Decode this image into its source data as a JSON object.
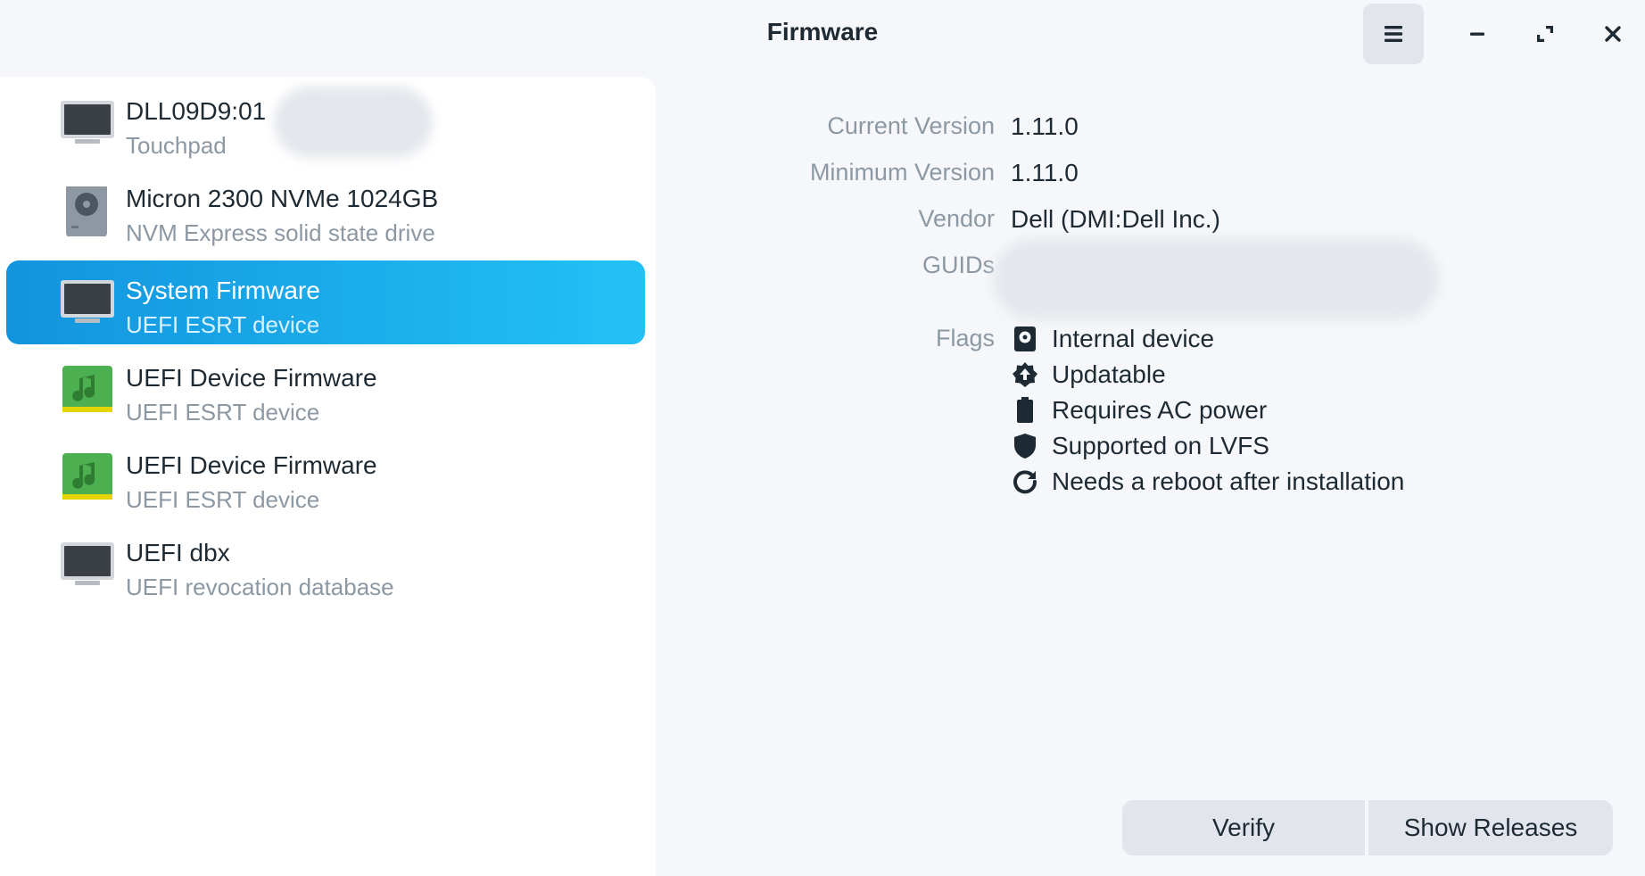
{
  "window": {
    "title": "Firmware",
    "menu_icon": "hamburger-icon",
    "minimize_icon": "minimize-icon",
    "maximize_icon": "maximize-icon",
    "close_icon": "close-icon"
  },
  "devices": [
    {
      "title": "DLL09D9:01",
      "subtitle": "Touchpad",
      "icon": "computer-icon",
      "selected": false
    },
    {
      "title": "Micron 2300 NVMe 1024GB",
      "subtitle": "NVM Express solid state drive",
      "icon": "drive-icon",
      "selected": false
    },
    {
      "title": "System Firmware",
      "subtitle": "UEFI ESRT device",
      "icon": "computer-icon",
      "selected": true
    },
    {
      "title": "UEFI Device Firmware",
      "subtitle": "UEFI ESRT device",
      "icon": "audio-card-icon",
      "selected": false
    },
    {
      "title": "UEFI Device Firmware",
      "subtitle": "UEFI ESRT device",
      "icon": "audio-card-icon",
      "selected": false
    },
    {
      "title": "UEFI dbx",
      "subtitle": "UEFI revocation database",
      "icon": "computer-icon",
      "selected": false
    }
  ],
  "details": {
    "current_version_label": "Current Version",
    "current_version": "1.11.0",
    "minimum_version_label": "Minimum Version",
    "minimum_version": "1.11.0",
    "vendor_label": "Vendor",
    "vendor": "Dell (DMI:Dell Inc.)",
    "guids_label": "GUIDs",
    "flags_label": "Flags",
    "flags": [
      {
        "text": "Internal device",
        "icon": "internal-device-icon"
      },
      {
        "text": "Updatable",
        "icon": "updatable-icon"
      },
      {
        "text": "Requires AC power",
        "icon": "battery-icon"
      },
      {
        "text": "Supported on LVFS",
        "icon": "shield-icon"
      },
      {
        "text": "Needs a reboot after installation",
        "icon": "reboot-icon"
      }
    ]
  },
  "actions": {
    "verify_label": "Verify",
    "show_releases_label": "Show Releases"
  },
  "colors": {
    "accent_start": "#1294de",
    "accent_end": "#23c1f6",
    "background": "#f5f7fa",
    "sidebar": "#ffffff",
    "button": "#e2e6ec"
  }
}
